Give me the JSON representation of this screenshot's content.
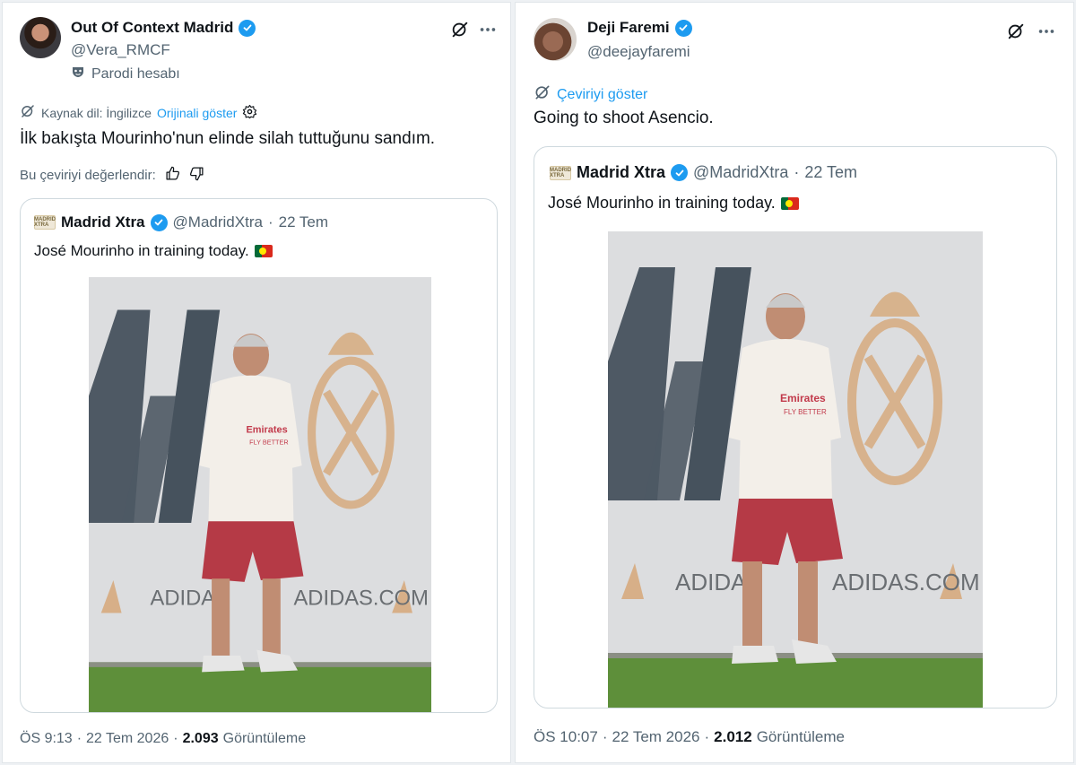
{
  "left_tweet": {
    "display_name": "Out Of Context Madrid",
    "handle": "@Vera_RMCF",
    "parody_label": "Parodi hesabı",
    "source_language": "Kaynak dil: İngilizce",
    "show_original": "Orijinali göster",
    "text": "İlk bakışta Mourinho'nun elinde silah tuttuğunu sandım.",
    "rate_translation": "Bu çeviriyi değerlendir:",
    "quote": {
      "logo_text": "MADRID XTRA",
      "display_name": "Madrid Xtra",
      "handle": "@MadridXtra",
      "separator": "·",
      "date": "22 Tem",
      "text": "José Mourinho in training today."
    },
    "timestamp": "ÖS 9:13",
    "separator": "·",
    "date": "22 Tem 2026",
    "views_count": "2.093",
    "views_label": "Görüntüleme"
  },
  "right_tweet": {
    "display_name": "Deji Faremi",
    "handle": "@deejayfaremi",
    "show_translation": "Çeviriyi göster",
    "text": "Going to shoot Asencio.",
    "quote": {
      "logo_text": "MADRID XTRA",
      "display_name": "Madrid Xtra",
      "handle": "@MadridXtra",
      "separator": "·",
      "date": "22 Tem",
      "text": "José Mourinho in training today."
    },
    "timestamp": "ÖS 10:07",
    "separator": "·",
    "date": "22 Tem 2026",
    "views_count": "2.012",
    "views_label": "Görüntüleme"
  },
  "photo": {
    "shirt_sponsor": "Emirates",
    "shirt_sponsor_line2": "FLY BETTER",
    "board_text_1": "ADIDAS",
    "board_text_2": "ADIDAS.COM"
  },
  "colors": {
    "accent": "#1d9bf0",
    "text_primary": "#0f1419",
    "text_secondary": "#536471",
    "border": "#cfd9de"
  }
}
